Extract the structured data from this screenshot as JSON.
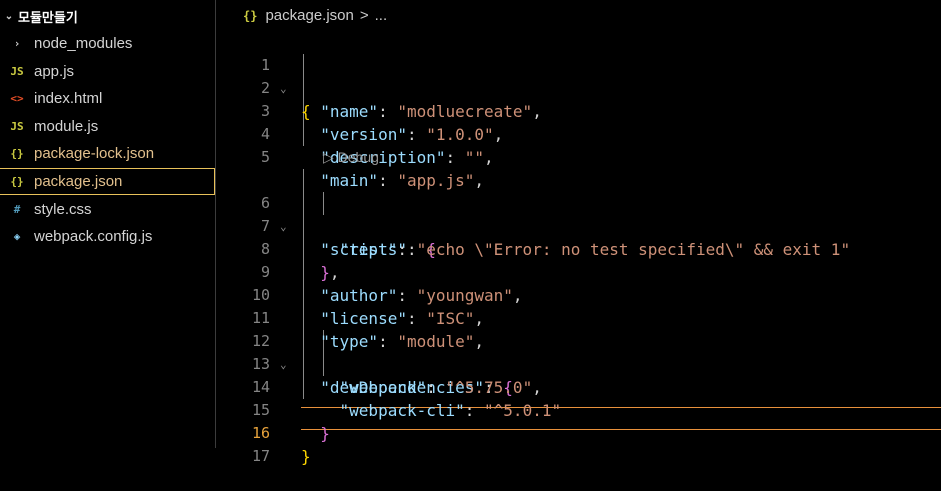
{
  "explorer": {
    "folder_name": "모듈만들기",
    "items": [
      {
        "label": "node_modules",
        "icon": "chevron-right-icon",
        "glyph": "›"
      },
      {
        "label": "app.js",
        "icon": "js-file-icon",
        "glyph": "JS"
      },
      {
        "label": "index.html",
        "icon": "html-file-icon",
        "glyph": "<>"
      },
      {
        "label": "module.js",
        "icon": "js-file-icon",
        "glyph": "JS"
      },
      {
        "label": "package-lock.json",
        "icon": "json-file-icon",
        "glyph": "{}"
      },
      {
        "label": "package.json",
        "icon": "json-file-icon",
        "glyph": "{}"
      },
      {
        "label": "style.css",
        "icon": "css-file-icon",
        "glyph": "#"
      },
      {
        "label": "webpack.config.js",
        "icon": "webpack-file-icon",
        "glyph": "◈"
      }
    ]
  },
  "breadcrumb": {
    "file": "package.json",
    "separator": ">",
    "rest": "...",
    "glyph": "{}"
  },
  "editor": {
    "line_numbers": [
      "1",
      "2",
      "3",
      "4",
      "5",
      "6",
      "7",
      "8",
      "9",
      "10",
      "11",
      "12",
      "13",
      "14",
      "15",
      "16",
      "17"
    ],
    "codelens": "▷ Debug",
    "lines": {
      "l1": {
        "b": "{"
      },
      "l2": {
        "k": "\"name\"",
        "p": ": ",
        "s": "\"modluecreate\"",
        "e": ","
      },
      "l3": {
        "k": "\"version\"",
        "p": ": ",
        "s": "\"1.0.0\"",
        "e": ","
      },
      "l4": {
        "k": "\"description\"",
        "p": ": ",
        "s": "\"\"",
        "e": ","
      },
      "l5": {
        "k": "\"main\"",
        "p": ": ",
        "s": "\"app.js\"",
        "e": ","
      },
      "l6": {
        "k": "\"scripts\"",
        "p": ": ",
        "b": "{"
      },
      "l7": {
        "k": "\"test\"",
        "p": ": ",
        "s": "\"echo \\\"Error: no test specified\\\" && exit 1\""
      },
      "l8": {
        "b": "}",
        "e": ","
      },
      "l9": {
        "k": "\"author\"",
        "p": ": ",
        "s": "\"youngwan\"",
        "e": ","
      },
      "l10": {
        "k": "\"license\"",
        "p": ": ",
        "s": "\"ISC\"",
        "e": ","
      },
      "l11": {
        "k": "\"type\"",
        "p": ": ",
        "s": "\"module\"",
        "e": ","
      },
      "l12": {
        "k": "\"devDependencies\"",
        "p": ": ",
        "b": "{"
      },
      "l13": {
        "k": "\"webpack\"",
        "p": ": ",
        "s": "\"^5.75.0\"",
        "e": ","
      },
      "l14": {
        "k": "\"webpack-cli\"",
        "p": ": ",
        "s": "\"^5.0.1\""
      },
      "l15": {
        "b": "}"
      },
      "l16": {
        "b": "}"
      }
    }
  },
  "colors": {
    "background": "#000000",
    "key": "#9cdcfe",
    "string": "#ce9178",
    "bracket_level1": "#ffd700",
    "bracket_level2": "#da70d6",
    "bracket_level3": "#179fff",
    "modified_file": "#e2c08d",
    "selection_border": "#e8c15a",
    "cursor_line_border": "#e8913c"
  }
}
